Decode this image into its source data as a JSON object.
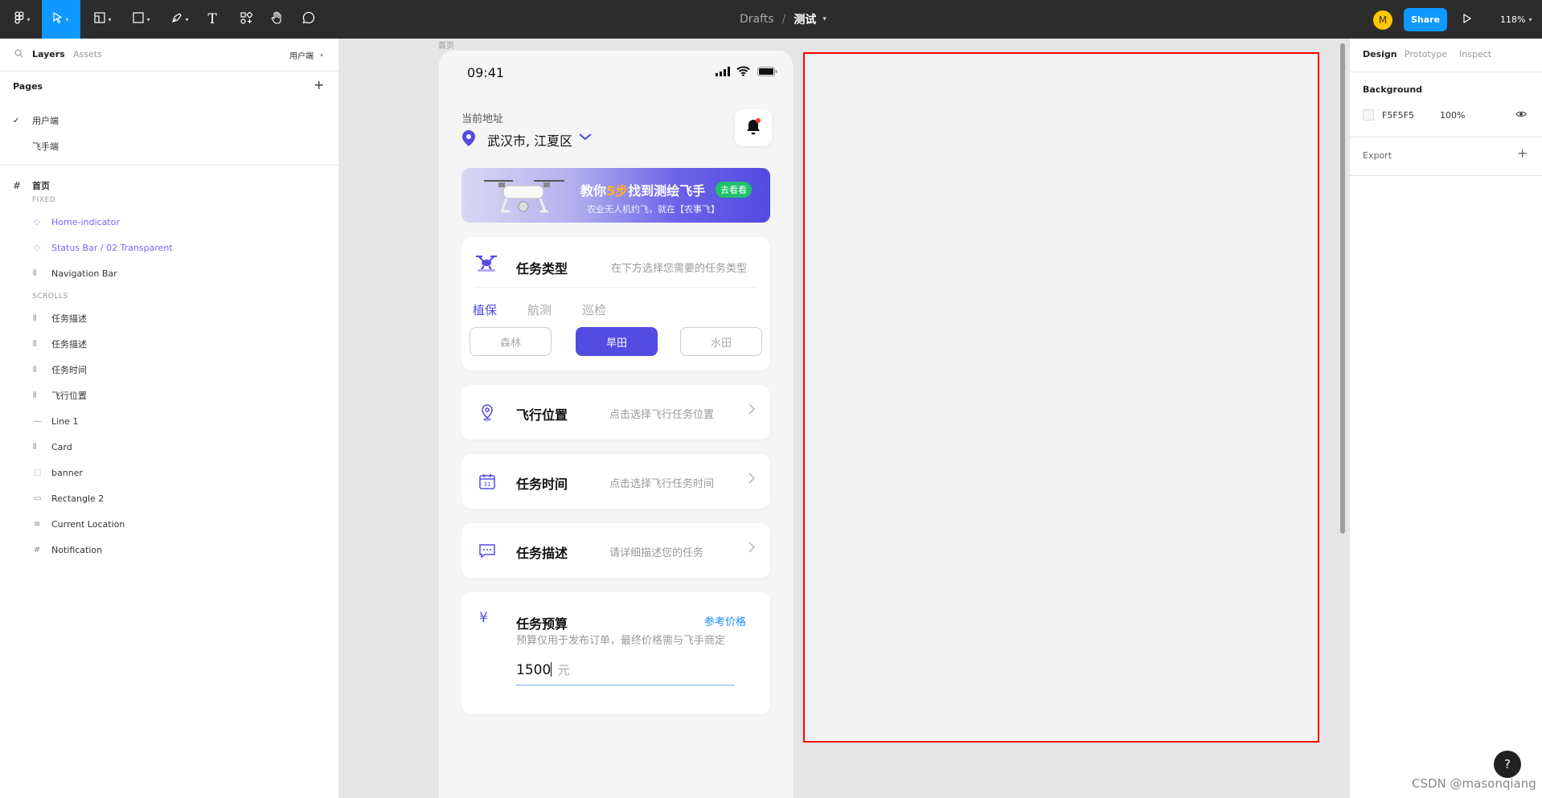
{
  "toolbar": {
    "breadcrumb_parent": "Drafts",
    "breadcrumb_sep": "/",
    "file_name": "测试",
    "avatar_initial": "M",
    "share_label": "Share",
    "zoom_level": "118%"
  },
  "left_panel": {
    "tabs": [
      "Layers",
      "Assets"
    ],
    "page_selector": "用户端",
    "pages_title": "Pages",
    "pages": [
      {
        "label": "用户端",
        "checked": true
      },
      {
        "label": "飞手端",
        "checked": false
      }
    ],
    "frame_name": "首页",
    "fixed_label": "FIXED",
    "fixed_layers": [
      {
        "label": "Home-indicator",
        "icon": "component-icon"
      },
      {
        "label": "Status Bar / 02 Transparent",
        "icon": "component-icon"
      },
      {
        "label": "Navigation Bar",
        "icon": "auto-layout-icon"
      }
    ],
    "scrolls_label": "SCROLLS",
    "scroll_layers": [
      {
        "label": "任务描述",
        "icon": "auto-layout-icon"
      },
      {
        "label": "任务描述",
        "icon": "auto-layout-icon"
      },
      {
        "label": "任务时间",
        "icon": "auto-layout-icon"
      },
      {
        "label": "飞行位置",
        "icon": "auto-layout-icon"
      },
      {
        "label": "Line 1",
        "icon": "line-icon"
      },
      {
        "label": "Card",
        "icon": "auto-layout-icon"
      },
      {
        "label": "banner",
        "icon": "dashed-frame-icon"
      },
      {
        "label": "Rectangle 2",
        "icon": "rectangle-icon"
      },
      {
        "label": "Current Location",
        "icon": "text-lines-icon"
      },
      {
        "label": "Notification",
        "icon": "frame-icon"
      }
    ]
  },
  "right_panel": {
    "tabs": [
      "Design",
      "Prototype",
      "Inspect"
    ],
    "background_title": "Background",
    "background_hex": "F5F5F5",
    "background_opacity": "100%",
    "export_label": "Export"
  },
  "canvas": {
    "frame_label": "首页",
    "help": "?",
    "watermark": "CSDN @masonqiang"
  },
  "phone": {
    "time": "09:41",
    "location_label": "当前地址",
    "location_value": "武汉市, 江夏区",
    "banner": {
      "title_pre": "教你",
      "title_highlight": "5步",
      "title_post": "找到测绘飞手",
      "badge": "去看看",
      "subtitle": "农业无人机约飞，就在【农事飞】"
    },
    "task_type": {
      "title": "任务类型",
      "hint": "在下方选择您需要的任务类型",
      "tabs": [
        "植保",
        "航测",
        "巡检"
      ],
      "chips": [
        "森林",
        "旱田",
        "水田"
      ],
      "selected_chip": "旱田"
    },
    "rows": [
      {
        "title": "飞行位置",
        "hint": "点击选择飞行任务位置"
      },
      {
        "title": "任务时间",
        "hint": "点击选择飞行任务时间"
      },
      {
        "title": "任务描述",
        "hint": "请详细描述您的任务"
      }
    ],
    "budget": {
      "icon": "¥",
      "title": "任务预算",
      "link": "参考价格",
      "note": "预算仅用于发布订单，最终价格需与飞手商定",
      "value": "1500",
      "unit": "元"
    }
  },
  "colors": {
    "accent": "#0d99ff",
    "primary_purple": "#524be0",
    "layer_purple": "#7b61ff",
    "highlight_orange": "#ffb020",
    "badge_green": "#1fc16b",
    "red_outline": "#ff0000"
  }
}
